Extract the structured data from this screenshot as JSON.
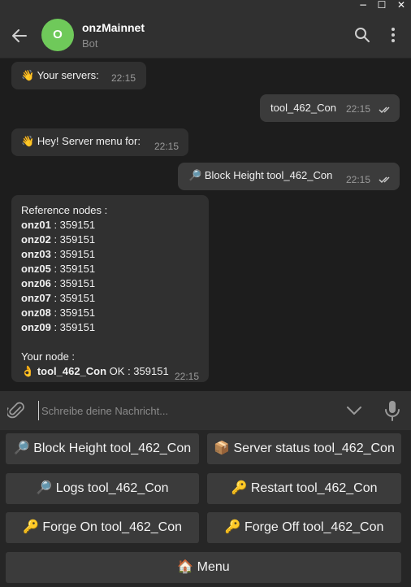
{
  "window": {
    "minimize": "−",
    "maximize": "☐",
    "close": "✕"
  },
  "header": {
    "avatar_letter": "O",
    "title": "onzMainnet",
    "subtitle": "Bot",
    "avatar_color": "#6fc95a"
  },
  "messages": [
    {
      "direction": "in",
      "emoji": "👋",
      "text": "Your servers:",
      "time": "22:15"
    },
    {
      "direction": "out",
      "text": "tool_462_Con",
      "time": "22:15",
      "read": true
    },
    {
      "direction": "in",
      "emoji": "👋",
      "text": "Hey! Server menu for:",
      "time": "22:15"
    },
    {
      "direction": "out",
      "emoji": "🔎",
      "text": "Block Height tool_462_Con",
      "time": "22:15",
      "read": true
    }
  ],
  "report": {
    "heading": "Reference nodes :",
    "nodes": [
      {
        "name": "onz01",
        "value": " : 359151"
      },
      {
        "name": "onz02",
        "value": " : 359151"
      },
      {
        "name": "onz03",
        "value": " : 359151"
      },
      {
        "name": "onz05",
        "value": " : 359151"
      },
      {
        "name": "onz06",
        "value": " : 359151"
      },
      {
        "name": "onz07",
        "value": " : 359151"
      },
      {
        "name": "onz08",
        "value": " : 359151"
      },
      {
        "name": "onz09",
        "value": " : 359151"
      }
    ],
    "your_node_label": "Your node :",
    "your_node_emoji": "👌",
    "your_node_name": "tool_462_Con",
    "your_node_status": " OK : 359151",
    "time": "22:15"
  },
  "input": {
    "placeholder": "Schreibe deine Nachricht..."
  },
  "keyboard": {
    "block_height": "🔎 Block Height tool_462_Con",
    "server_status": "📦 Server status tool_462_Con",
    "logs": "🔎 Logs tool_462_Con",
    "restart": "🔑 Restart tool_462_Con",
    "forge_on": "🔑 Forge On tool_462_Con",
    "forge_off": "🔑 Forge Off tool_462_Con",
    "menu": "🏠 Menu"
  },
  "colors": {
    "accent_read_ticks": "#d0d0d0",
    "background": "#1d1d1d",
    "bubble_in": "#303030",
    "bubble_out": "#3b3b3b"
  }
}
